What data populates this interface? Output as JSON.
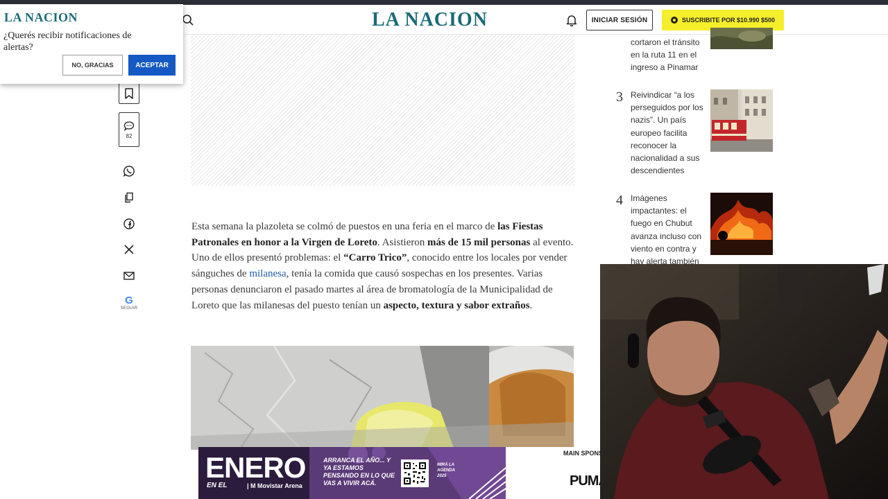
{
  "header": {
    "logo": "LA NACION",
    "login_label": "INICIAR SESIÓN",
    "subscribe_label": "SUSCRIBITE POR $10.990 $500"
  },
  "notification": {
    "logo": "LA NACION",
    "question": "¿Querés recibir notificaciones de alertas?",
    "decline_label": "NO, GRACIAS",
    "accept_label": "ACEPTAR"
  },
  "tools": {
    "comment_count": "82",
    "google_follow_label": "SEGUIR"
  },
  "article": {
    "p1": "Esta semana la plazoleta se colmó de puestos en una feria en el marco de ",
    "b1": "las Fiestas Patronales en honor a la Virgen de Loreto",
    "p2": ". Asistieron ",
    "b2": "más de 15 mil personas",
    "p3": " al evento. Uno de ellos presentó problemas: el ",
    "b3": "“Carro Trico”",
    "p4": ", conocido entre los locales por vender sánguches de ",
    "link": "milanesa",
    "p5": ", tenía la comida que causó sospechas en los presentes. Varias personas denunciaron el pasado martes al área de bromatología de la Municipalidad de Loreto que las milanesas del puesto tenían un ",
    "b4": "aspecto, textura y sabor extraños",
    "p6": "."
  },
  "trending": [
    {
      "num": "",
      "text": "cortaron el tránsito en la ruta 11 en el ingreso a Pinamar"
    },
    {
      "num": "3",
      "text": "Reivindicar “a los perseguidos por los nazis”. Un país europeo facilita reconocer la nacionalidad a sus descendientes"
    },
    {
      "num": "4",
      "text": "Imágenes impactantes: el fuego en Chubut avanza incluso con viento en contra y hay alerta también"
    }
  ],
  "banner": {
    "headline": "ENERO",
    "en_el": "EN EL",
    "venue": "Movistar Arena",
    "message": "ARRANCA EL AÑO... Y YA ESTAMOS PENSANDO EN LO QUE VAS A VIVIR ACÁ.",
    "agenda": "MIRÁ LA AGENDA 2025",
    "sponsor_label": "MAIN SPONS",
    "sponsor_brand": "PUMA"
  },
  "colors": {
    "brand": "#1a6b77",
    "subscribe_bg": "#f5ee2a",
    "accept_bg": "#1459c4",
    "link": "#1d5fa8"
  }
}
